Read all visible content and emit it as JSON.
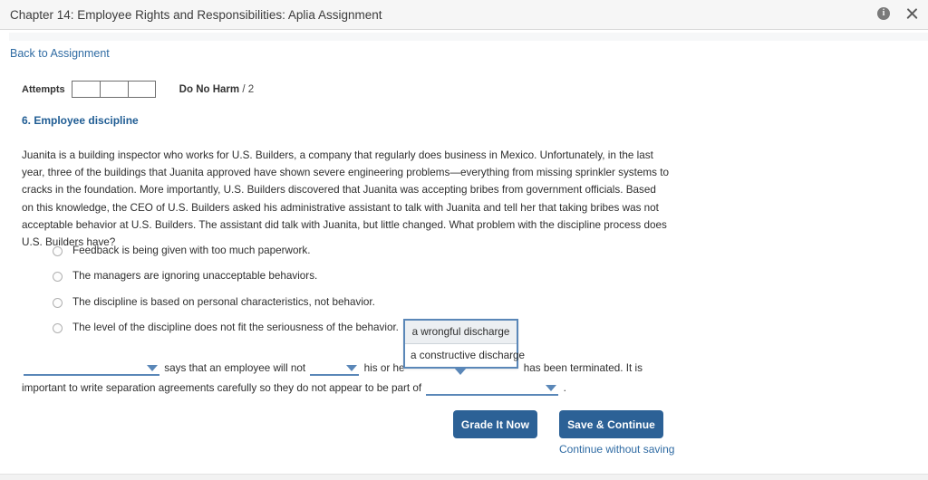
{
  "window": {
    "title": "Chapter 14: Employee Rights and Responsibilities: Aplia Assignment",
    "info_icon": "info-icon",
    "close_icon": "close-icon"
  },
  "nav": {
    "back_link": "Back to Assignment"
  },
  "attempts": {
    "label": "Attempts",
    "boxes": [
      "",
      "",
      ""
    ],
    "score_name": "Do No Harm",
    "score_denominator": "/ 2"
  },
  "question": {
    "heading": "6. Employee discipline",
    "body": "Juanita is a building inspector who works for U.S. Builders, a company that regularly does business in Mexico. Unfortunately, in the last year, three of the buildings that Juanita approved have shown severe engineering problems—everything from missing sprinkler systems to cracks in the foundation. More importantly, U.S. Builders discovered that Juanita was accepting bribes from government officials. Based on this knowledge, the CEO of U.S. Builders asked his administrative assistant to talk with Juanita and tell her that taking bribes was not acceptable behavior at U.S. Builders. The assistant did talk with Juanita, but little changed. What problem with the discipline process does U.S. Builders have?",
    "options": [
      "Feedback is being given with too much paperwork.",
      "The managers are ignoring unacceptable behaviors.",
      "The discipline is based on personal characteristics, not behavior.",
      "The level of the discipline does not fit the seriousness of the behavior."
    ]
  },
  "fill_in": {
    "line1_part1": "says that an employee will not",
    "line1_part2": "his or he",
    "line1_part3": "has been terminated. It is",
    "line2_part1": "important to write separation agreements carefully so they do not appear to be part of",
    "line2_end": ".",
    "blank1_value": "",
    "blank2_value": "",
    "blank3_value": ""
  },
  "dropdown": {
    "open": true,
    "options": [
      "a wrongful discharge",
      "a constructive discharge"
    ],
    "highlighted_index": 0
  },
  "actions": {
    "grade_label": "Grade It Now",
    "save_label": "Save & Continue",
    "continue_link": "Continue without saving"
  },
  "colors": {
    "accent_blue": "#2c6196",
    "link_blue": "#2f6ba3",
    "heading_blue": "#1f5c93",
    "dropdown_border": "#5a87b8",
    "header_bg": "#f6f6f6"
  }
}
